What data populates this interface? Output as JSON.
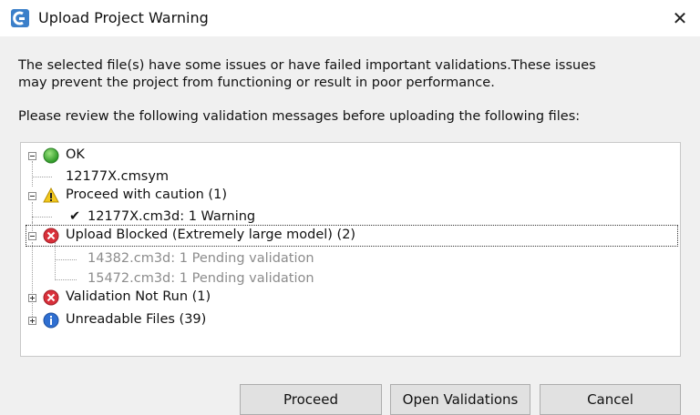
{
  "window": {
    "title": "Upload Project Warning",
    "close_glyph": "✕"
  },
  "message": {
    "line1": "The selected file(s) have some issues or have failed important validations.These issues",
    "line2": "may prevent the project from functioning or result in poor performance.",
    "line3": "Please review the following validation messages before uploading the following files:"
  },
  "tree": {
    "ok": {
      "label": "OK",
      "icon": "green-check-circle-icon",
      "children": [
        "12177X.cmsym"
      ]
    },
    "caution": {
      "label": "Proceed with caution (1)",
      "icon": "warning-triangle-icon",
      "children": [
        "12177X.cm3d: 1 Warning"
      ],
      "child_prefix": "✔"
    },
    "blocked": {
      "label": "Upload Blocked (Extremely large model) (2)",
      "icon": "red-x-circle-icon",
      "children": [
        "14382.cm3d: 1 Pending validation",
        "15472.cm3d: 1 Pending validation"
      ]
    },
    "not_run": {
      "label": "Validation Not Run (1)",
      "icon": "red-x-circle-icon"
    },
    "unreadable": {
      "label": "Unreadable Files (39)",
      "icon": "info-circle-icon"
    }
  },
  "buttons": {
    "proceed": "Proceed",
    "open_validations": "Open Validations",
    "cancel": "Cancel"
  },
  "colors": {
    "ok_green": "#3aa832",
    "warning_yellow": "#f2c81e",
    "error_red": "#d9303a",
    "info_blue": "#2f6fd1"
  }
}
